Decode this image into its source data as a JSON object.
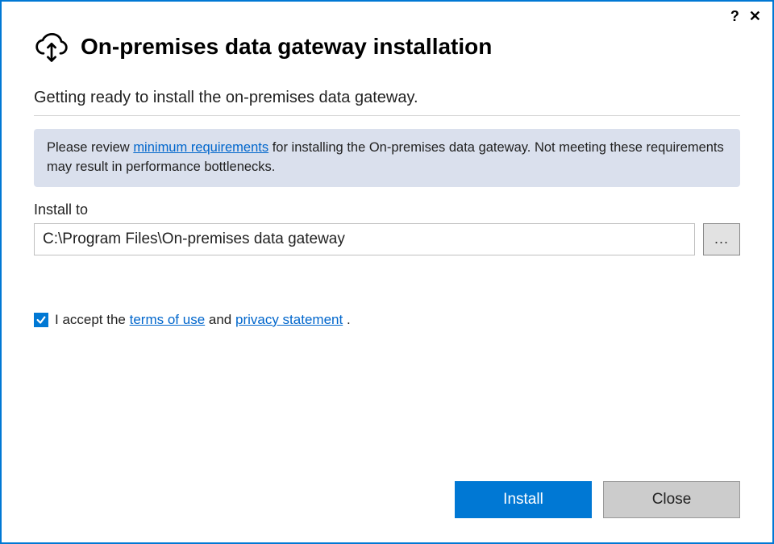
{
  "header": {
    "title": "On-premises data gateway installation"
  },
  "subtitle": "Getting ready to install the on-premises data gateway.",
  "info": {
    "prefix": "Please review ",
    "link": "minimum requirements",
    "suffix": " for installing the On-premises data gateway. Not meeting these requirements may result in performance bottlenecks."
  },
  "install": {
    "label": "Install to",
    "path": "C:\\Program Files\\On-premises data gateway",
    "browse_label": "..."
  },
  "accept": {
    "prefix": "I accept the ",
    "terms_link": "terms of use",
    "middle": " and ",
    "privacy_link": "privacy statement",
    "suffix": " .",
    "checked": true
  },
  "buttons": {
    "install": "Install",
    "close": "Close"
  }
}
